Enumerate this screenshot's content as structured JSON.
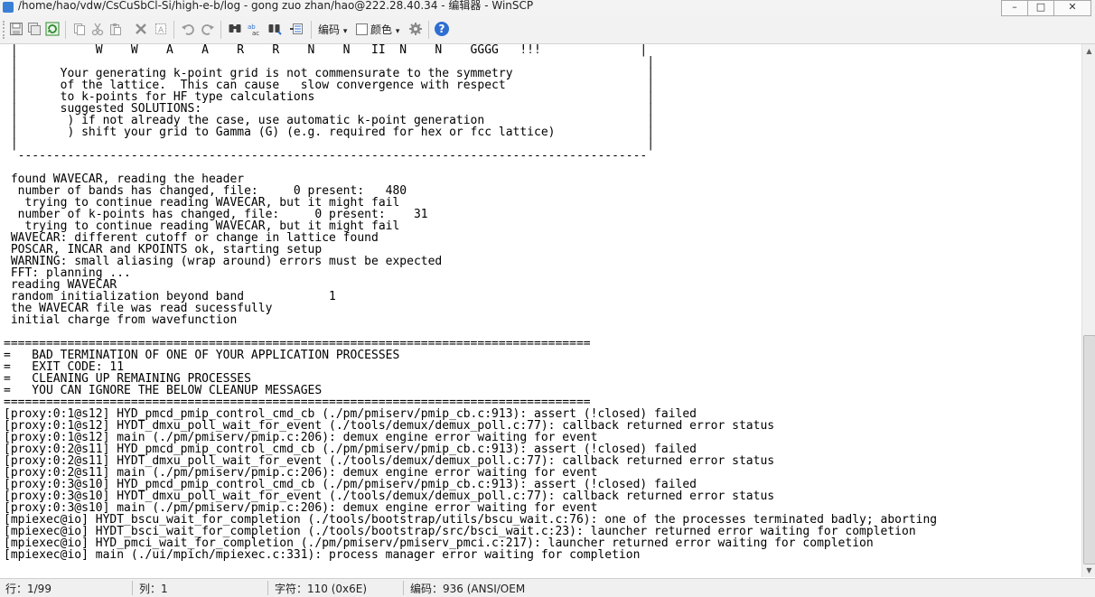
{
  "window": {
    "title": "/home/hao/vdw/CsCuSbCl-Si/high-e-b/log - gong zuo zhan/hao@222.28.40.34 - 编辑器 - WinSCP",
    "minimize": "–",
    "maximize": "□",
    "close": "✕"
  },
  "toolbar": {
    "encoding_label": "编码",
    "color_label": "颜色",
    "dropdown_glyph": "▾",
    "help_glyph": "?"
  },
  "editor": {
    "lines": [
      " |           W    W    A    A    R    R    N    N   II  N    N    GGGG   !!!              |",
      " |                                                                                         |",
      " |      Your generating k-point grid is not commensurate to the symmetry                   |",
      " |      of the lattice.  This can cause   slow convergence with respect                    |",
      " |      to k-points for HF type calculations                                               |",
      " |      suggested SOLUTIONS:                                                               |",
      " |       ) if not already the case, use automatic k-point generation                       |",
      " |       ) shift your grid to Gamma (G) (e.g. required for hex or fcc lattice)             |",
      " |                                                                                         |",
      "  -----------------------------------------------------------------------------------------",
      "",
      " found WAVECAR, reading the header",
      "  number of bands has changed, file:     0 present:   480",
      "   trying to continue reading WAVECAR, but it might fail",
      "  number of k-points has changed, file:     0 present:    31",
      "   trying to continue reading WAVECAR, but it might fail",
      " WAVECAR: different cutoff or change in lattice found",
      " POSCAR, INCAR and KPOINTS ok, starting setup",
      " WARNING: small aliasing (wrap around) errors must be expected",
      " FFT: planning ...",
      " reading WAVECAR",
      " random initialization beyond band            1",
      " the WAVECAR file was read sucessfully",
      " initial charge from wavefunction",
      "",
      "===================================================================================",
      "=   BAD TERMINATION OF ONE OF YOUR APPLICATION PROCESSES",
      "=   EXIT CODE: 11",
      "=   CLEANING UP REMAINING PROCESSES",
      "=   YOU CAN IGNORE THE BELOW CLEANUP MESSAGES",
      "===================================================================================",
      "[proxy:0:1@s12] HYD_pmcd_pmip_control_cmd_cb (./pm/pmiserv/pmip_cb.c:913): assert (!closed) failed",
      "[proxy:0:1@s12] HYDT_dmxu_poll_wait_for_event (./tools/demux/demux_poll.c:77): callback returned error status",
      "[proxy:0:1@s12] main (./pm/pmiserv/pmip.c:206): demux engine error waiting for event",
      "[proxy:0:2@s11] HYD_pmcd_pmip_control_cmd_cb (./pm/pmiserv/pmip_cb.c:913): assert (!closed) failed",
      "[proxy:0:2@s11] HYDT_dmxu_poll_wait_for_event (./tools/demux/demux_poll.c:77): callback returned error status",
      "[proxy:0:2@s11] main (./pm/pmiserv/pmip.c:206): demux engine error waiting for event",
      "[proxy:0:3@s10] HYD_pmcd_pmip_control_cmd_cb (./pm/pmiserv/pmip_cb.c:913): assert (!closed) failed",
      "[proxy:0:3@s10] HYDT_dmxu_poll_wait_for_event (./tools/demux/demux_poll.c:77): callback returned error status",
      "[proxy:0:3@s10] main (./pm/pmiserv/pmip.c:206): demux engine error waiting for event",
      "[mpiexec@io] HYDT_bscu_wait_for_completion (./tools/bootstrap/utils/bscu_wait.c:76): one of the processes terminated badly; aborting",
      "[mpiexec@io] HYDT_bsci_wait_for_completion (./tools/bootstrap/src/bsci_wait.c:23): launcher returned error waiting for completion",
      "[mpiexec@io] HYD_pmci_wait_for_completion (./pm/pmiserv/pmiserv_pmci.c:217): launcher returned error waiting for completion",
      "[mpiexec@io] main (./ui/mpich/mpiexec.c:331): process manager error waiting for completion"
    ]
  },
  "scrollbar": {
    "up_glyph": "▲",
    "down_glyph": "▼"
  },
  "statusbar": {
    "line": "行：1/99",
    "column": "列：1",
    "char": "字符：110 (0x6E)",
    "encoding": "编码：936   (ANSI/OEM"
  },
  "icons": {
    "colors": {
      "blue": "#2f6fd1",
      "green": "#2e8b2e",
      "gray": "#9a9a9a",
      "dark": "#404040"
    }
  }
}
